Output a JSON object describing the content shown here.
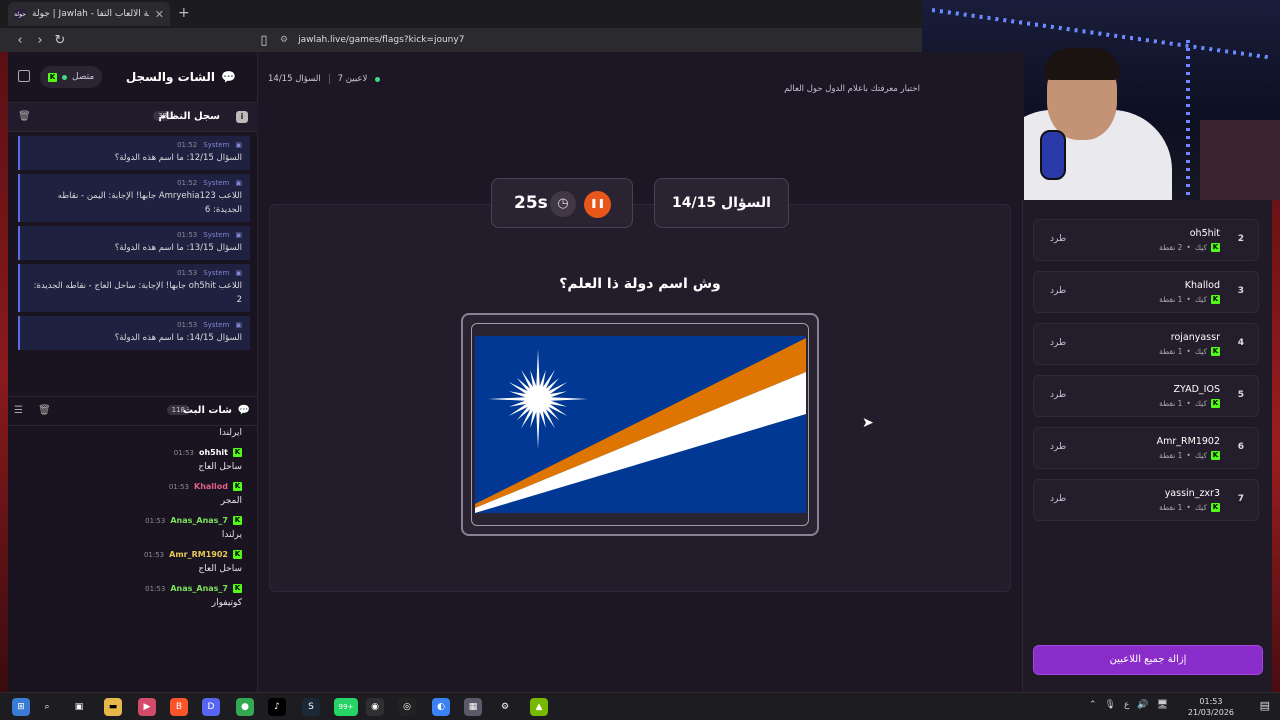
{
  "browser": {
    "tab_title": "جولة | Jawlah - منصة الألعاب التفا",
    "tab_favicon": "جولة",
    "url": "jawlah.live/games/flags?kick=jouny7"
  },
  "sidebar": {
    "title": "الشات والسجل",
    "connection_status": "متصل",
    "system_log": {
      "title": "سجل النظام",
      "count": "38",
      "messages": [
        {
          "sender": "System",
          "time": "01:52",
          "text": "السؤال 12/15: ما اسم هذه الدولة؟"
        },
        {
          "sender": "System",
          "time": "01:52",
          "text": "اللاعب Amryehia123 جابها! الإجابة: اليمن - نقاطه الجديدة: 6"
        },
        {
          "sender": "System",
          "time": "01:53",
          "text": "السؤال 13/15: ما اسم هذه الدولة؟"
        },
        {
          "sender": "System",
          "time": "01:53",
          "text": "اللاعب oh5hit جابها! الإجابة: ساحل العاج - نقاطه الجديدة: 2"
        },
        {
          "sender": "System",
          "time": "01:53",
          "text": "السؤال 14/15: ما اسم هذه الدولة؟"
        }
      ]
    },
    "stream_chat": {
      "title": "شات البث",
      "count": "118",
      "messages": [
        {
          "user": "",
          "time": "",
          "text": "أيرلندا",
          "color": "#e6e2ec"
        },
        {
          "user": "oh5hit",
          "time": "01:53",
          "text": "ساحل العاج",
          "color": "#ffffff"
        },
        {
          "user": "Khallod",
          "time": "01:53",
          "text": "المجر",
          "color": "#e0608a"
        },
        {
          "user": "Anas_Anas_7",
          "time": "01:53",
          "text": "يرلندا",
          "color": "#7be35a"
        },
        {
          "user": "Amr_RM1902",
          "time": "01:53",
          "text": "ساحل العاج",
          "color": "#e7c85a"
        },
        {
          "user": "Anas_Anas_7",
          "time": "01:53",
          "text": "كوتيفوار",
          "color": "#7be35a"
        }
      ]
    }
  },
  "game": {
    "players_online": "7 لاعبين",
    "question_progress": "السؤال 14/15",
    "subtitle": "اختبار معرفتك بأعلام الدول حول العالم",
    "timer": "25s",
    "question_label": "السؤال 14/15",
    "question_text": "وش اسم دولة ذا العلم؟",
    "flag_colors": {
      "blue": "#003893",
      "orange": "#dd7500",
      "white": "#ffffff"
    }
  },
  "players": [
    {
      "rank": "2",
      "name": "oh5hit",
      "platform": "كيك",
      "points": "2 نقطة",
      "kick_label": "طرد"
    },
    {
      "rank": "3",
      "name": "Khallod",
      "platform": "كيك",
      "points": "1 نقطة",
      "kick_label": "طرد"
    },
    {
      "rank": "4",
      "name": "rojanyassr",
      "platform": "كيك",
      "points": "1 نقطة",
      "kick_label": "طرد"
    },
    {
      "rank": "5",
      "name": "ZYAD_IOS",
      "platform": "كيك",
      "points": "1 نقطة",
      "kick_label": "طرد"
    },
    {
      "rank": "6",
      "name": "Amr_RM1902",
      "platform": "كيك",
      "points": "1 نقطة",
      "kick_label": "طرد"
    },
    {
      "rank": "7",
      "name": "yassin_zxr3",
      "platform": "كيك",
      "points": "1 نقطة",
      "kick_label": "طرد"
    }
  ],
  "remove_all_label": "إزالة جميع اللاعبين",
  "taskbar": {
    "time": "01:53",
    "date": "21/03/2026",
    "lang": "ع",
    "badge": "99+"
  }
}
